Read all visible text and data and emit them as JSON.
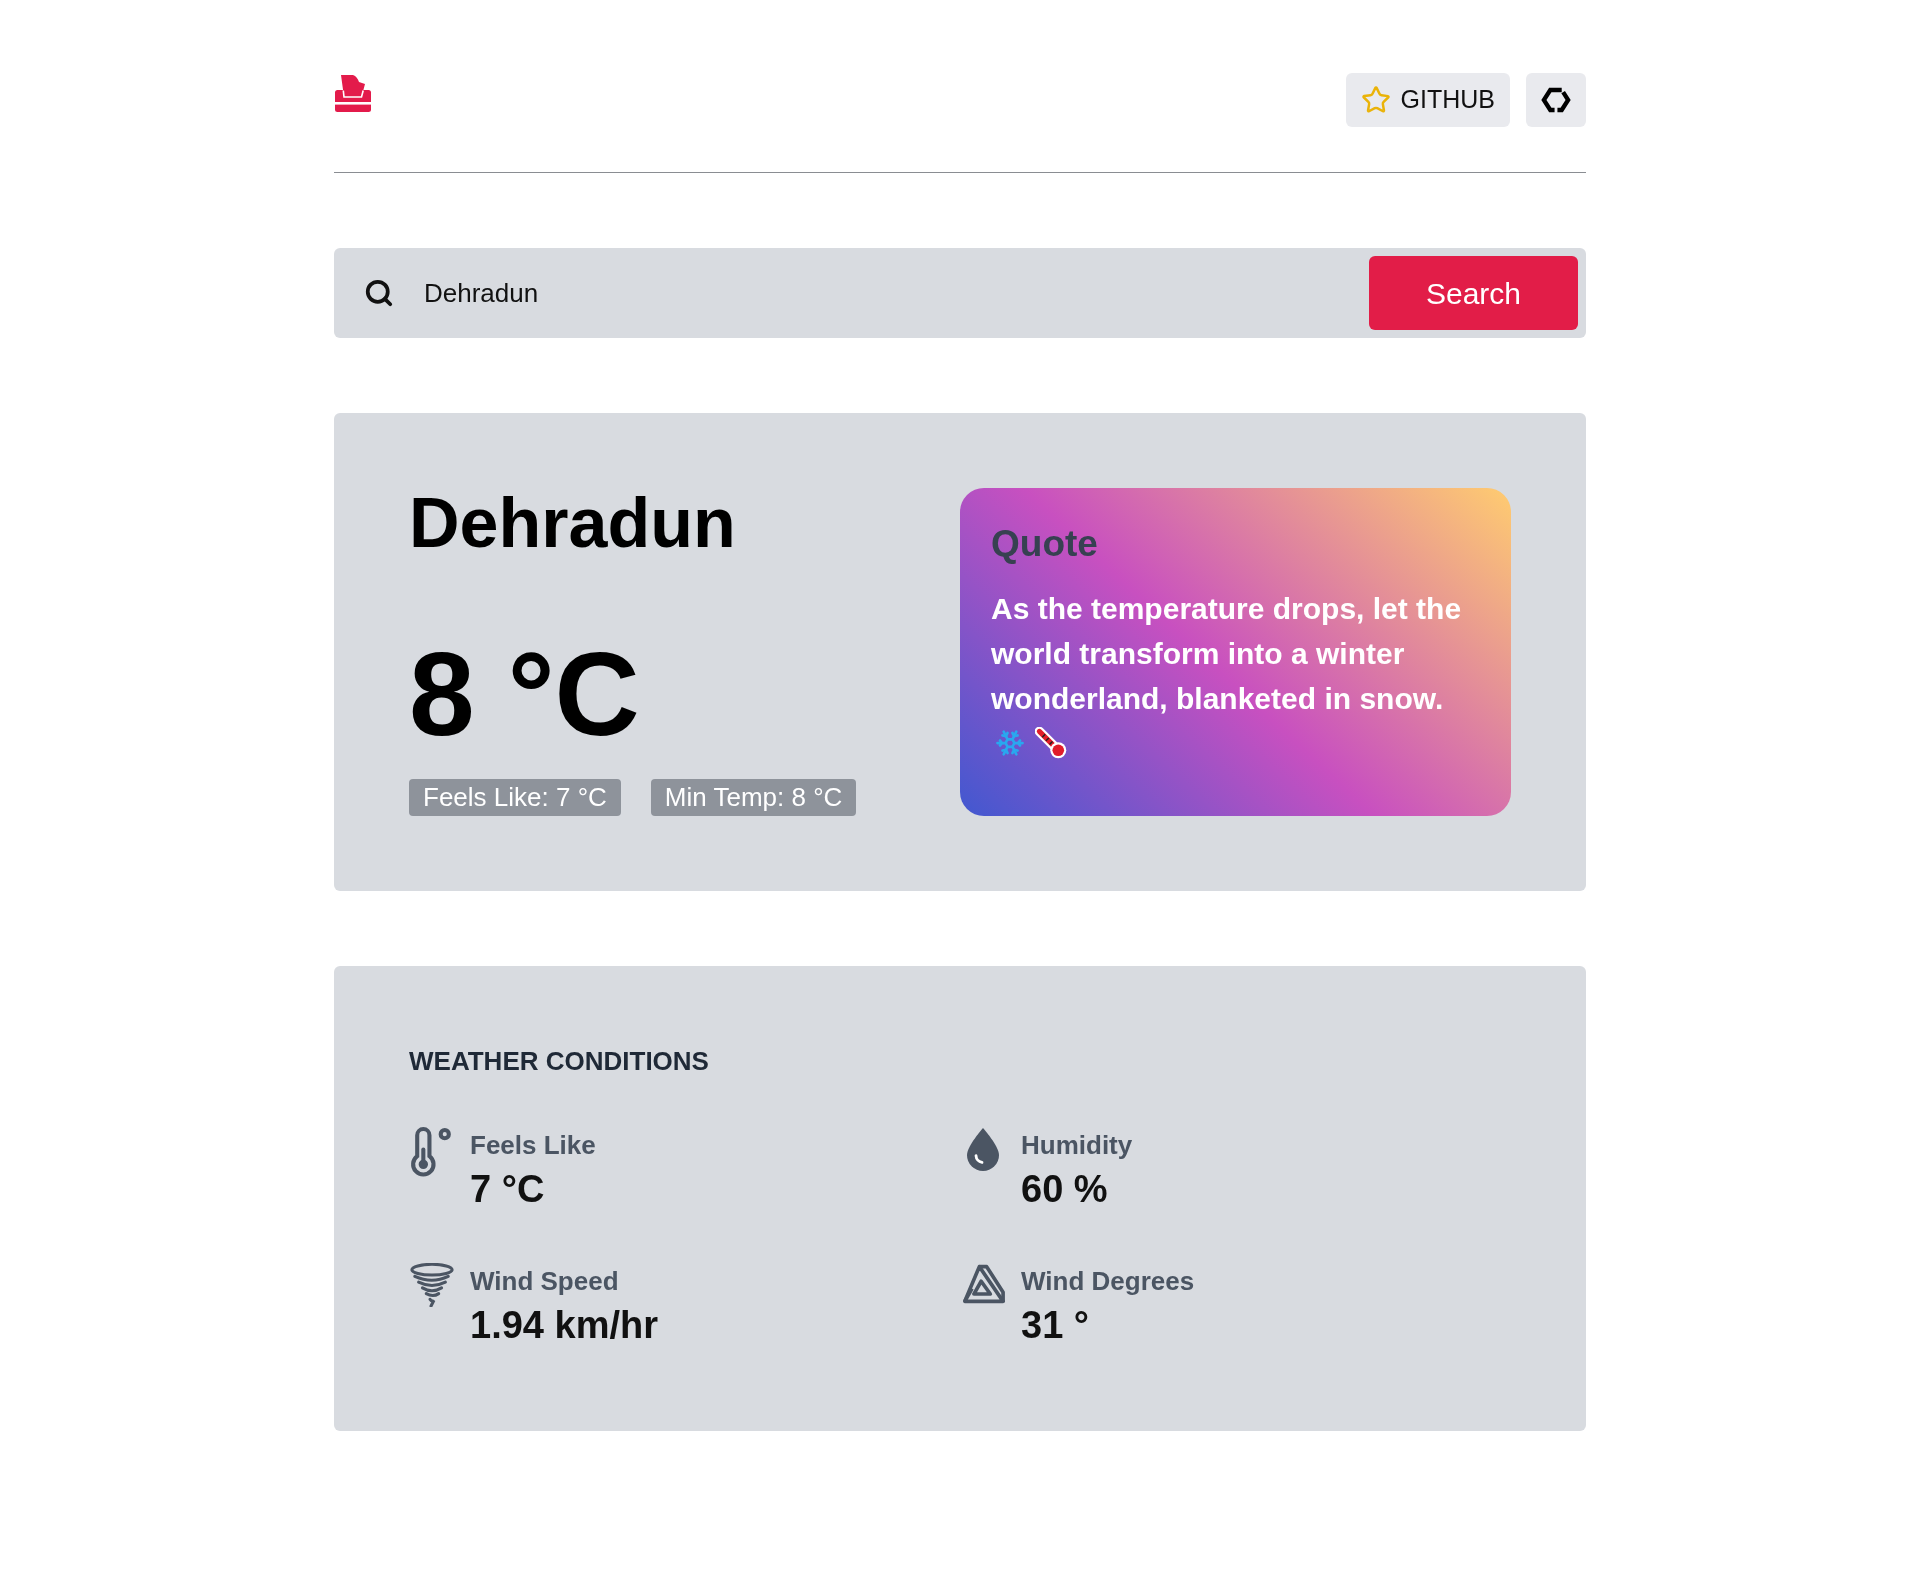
{
  "header": {
    "github_button": {
      "label": "GITHUB"
    }
  },
  "search": {
    "value": "Dehradun",
    "button": "Search"
  },
  "current": {
    "city": "Dehradun",
    "temperature": "8 °C",
    "badges": [
      "Feels Like: 7 °C",
      "Min Temp: 8 °C"
    ],
    "quote": {
      "title": "Quote",
      "text": "As the temperature drops, let the world transform into a winter wonderland, blanketed in snow."
    }
  },
  "conditions": {
    "title": "WEATHER CONDITIONS",
    "items": [
      {
        "kind": "feels_like",
        "label": "Feels Like",
        "value": "7 °C"
      },
      {
        "kind": "humidity",
        "label": "Humidity",
        "value": "60 %"
      },
      {
        "kind": "wind_speed",
        "label": "Wind Speed",
        "value": "1.94 km/hr"
      },
      {
        "kind": "wind_degrees",
        "label": "Wind Degrees",
        "value": "31 °"
      }
    ]
  }
}
